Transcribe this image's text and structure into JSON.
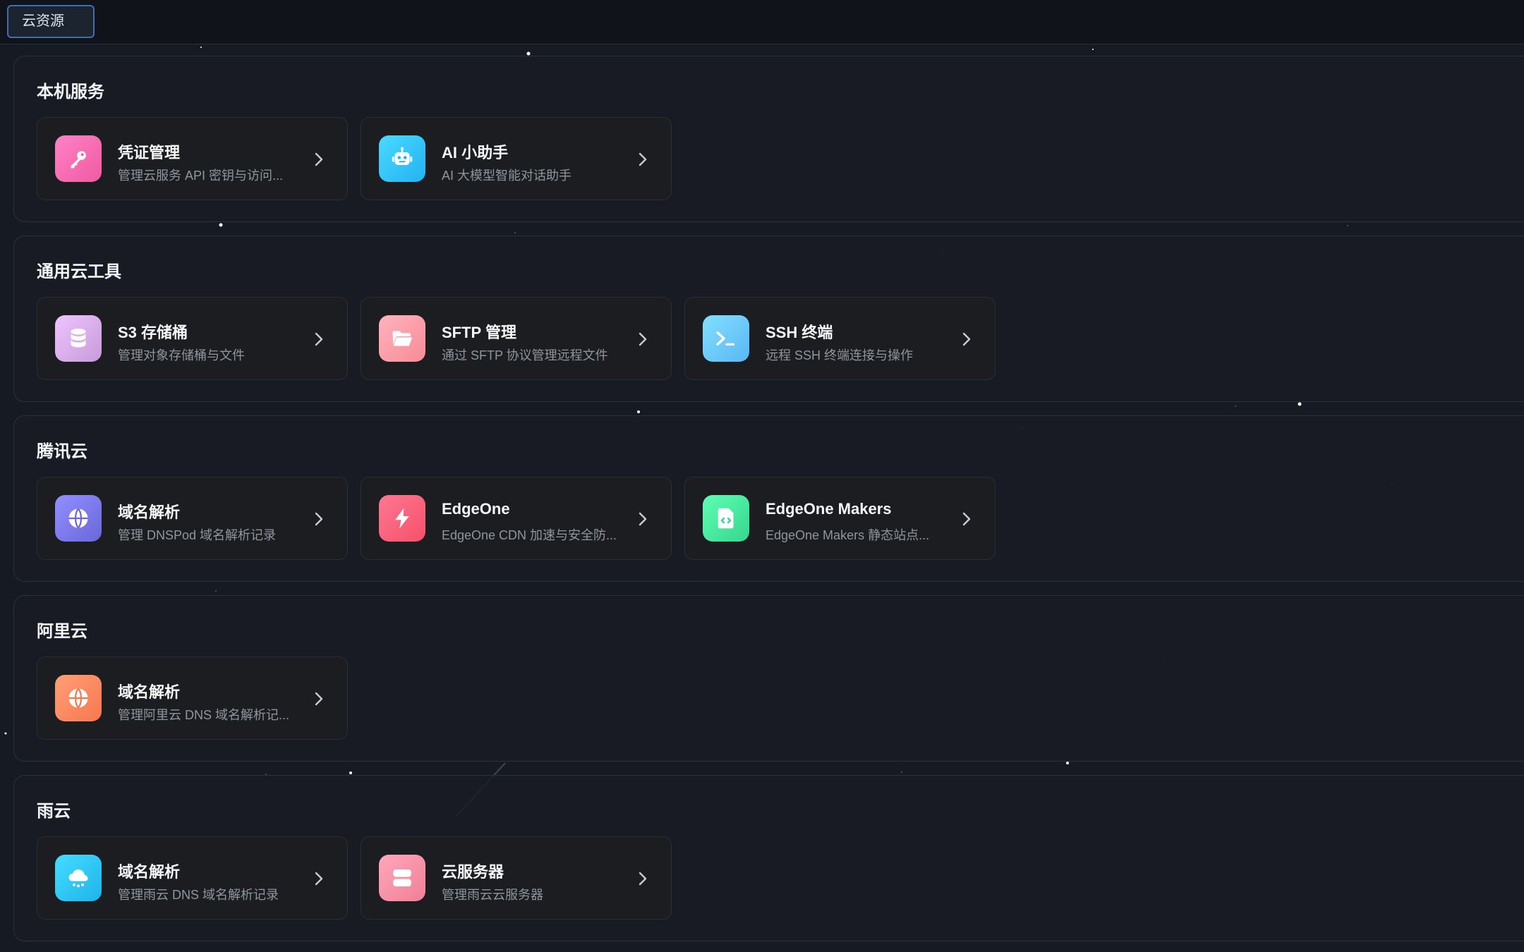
{
  "tab": {
    "label": "云资源"
  },
  "sections": [
    {
      "title": "本机服务",
      "cards": [
        {
          "title": "凭证管理",
          "desc": "管理云服务 API 密钥与访问...",
          "icon": "key-icon",
          "color": "#f05aa0"
        },
        {
          "title": "AI 小助手",
          "desc": "AI 大模型智能对话助手",
          "icon": "robot-icon",
          "color": "#22b2f2"
        }
      ]
    },
    {
      "title": "通用云工具",
      "cards": [
        {
          "title": "S3 存储桶",
          "desc": "管理对象存储桶与文件",
          "icon": "database-icon",
          "color": "#c79bd8"
        },
        {
          "title": "SFTP 管理",
          "desc": "通过 SFTP 协议管理远程文件",
          "icon": "folder-icon",
          "color": "#f78b96"
        },
        {
          "title": "SSH 终端",
          "desc": "远程 SSH 终端连接与操作",
          "icon": "terminal-icon",
          "color": "#5ab7f3"
        }
      ]
    },
    {
      "title": "腾讯云",
      "cards": [
        {
          "title": "域名解析",
          "desc": "管理 DNSPod 域名解析记录",
          "icon": "globe-icon",
          "color": "#6a67d8"
        },
        {
          "title": "EdgeOne",
          "desc": "EdgeOne CDN 加速与安全防...",
          "icon": "lightning-icon",
          "color": "#f5506a"
        },
        {
          "title": "EdgeOne Makers",
          "desc": "EdgeOne Makers 静态站点...",
          "icon": "code-file-icon",
          "color": "#36d68d"
        }
      ]
    },
    {
      "title": "阿里云",
      "cards": [
        {
          "title": "域名解析",
          "desc": "管理阿里云 DNS 域名解析记...",
          "icon": "globe-icon",
          "color": "#f7774f"
        }
      ]
    },
    {
      "title": "雨云",
      "cards": [
        {
          "title": "域名解析",
          "desc": "管理雨云 DNS 域名解析记录",
          "icon": "cloud-rain-icon",
          "color": "#1db4ea"
        },
        {
          "title": "云服务器",
          "desc": "管理雨云云服务器",
          "icon": "server-icon",
          "color": "#f07f95"
        }
      ]
    }
  ]
}
